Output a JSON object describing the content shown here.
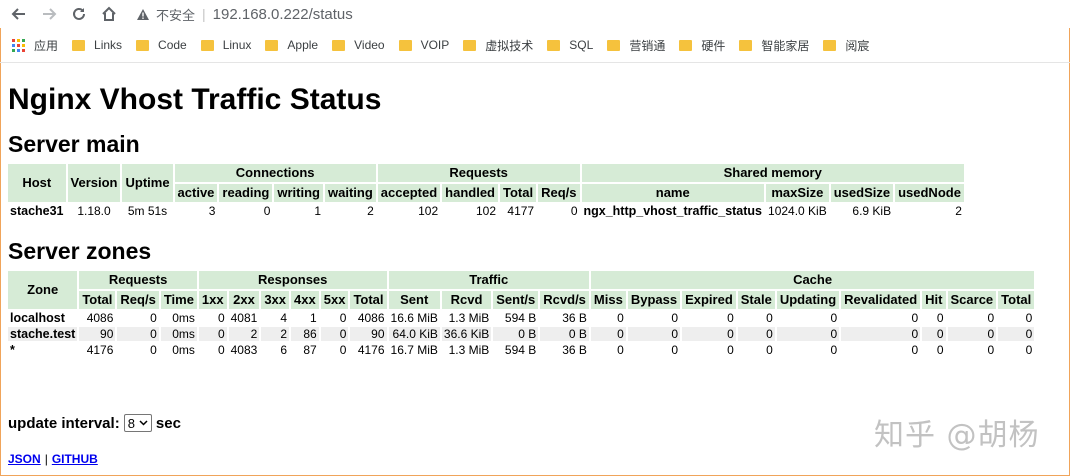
{
  "browser": {
    "insecure_label": "不安全",
    "url": "192.168.0.222/status",
    "bookmarks": [
      {
        "label": "应用",
        "icon": "apps-icon"
      },
      {
        "label": "Links",
        "icon": "folder-icon"
      },
      {
        "label": "Code",
        "icon": "folder-icon"
      },
      {
        "label": "Linux",
        "icon": "folder-icon"
      },
      {
        "label": "Apple",
        "icon": "folder-icon"
      },
      {
        "label": "Video",
        "icon": "folder-icon"
      },
      {
        "label": "VOIP",
        "icon": "folder-icon"
      },
      {
        "label": "虚拟技术",
        "icon": "folder-icon"
      },
      {
        "label": "SQL",
        "icon": "folder-icon"
      },
      {
        "label": "营销通",
        "icon": "folder-icon"
      },
      {
        "label": "硬件",
        "icon": "folder-icon"
      },
      {
        "label": "智能家居",
        "icon": "folder-icon"
      },
      {
        "label": "阅宸",
        "icon": "folder-icon"
      }
    ],
    "icons": {
      "back": "back-arrow-icon",
      "forward": "forward-arrow-icon",
      "reload": "reload-icon",
      "home": "home-icon",
      "warning": "warning-triangle-icon"
    }
  },
  "page": {
    "title": "Nginx Vhost Traffic Status",
    "server_main": {
      "heading": "Server main",
      "groups": {
        "connections": "Connections",
        "requests": "Requests",
        "shared_memory": "Shared memory"
      },
      "headers": {
        "host": "Host",
        "version": "Version",
        "uptime": "Uptime",
        "active": "active",
        "reading": "reading",
        "writing": "writing",
        "waiting": "waiting",
        "accepted": "accepted",
        "handled": "handled",
        "total": "Total",
        "req_s": "Req/s",
        "name": "name",
        "max_size": "maxSize",
        "used_size": "usedSize",
        "used_node": "usedNode"
      },
      "row": {
        "host": "stache31",
        "version": "1.18.0",
        "uptime": "5m 51s",
        "active": "3",
        "reading": "0",
        "writing": "1",
        "waiting": "2",
        "accepted": "102",
        "handled": "102",
        "total": "4177",
        "req_s": "0",
        "name": "ngx_http_vhost_traffic_status",
        "max_size": "1024.0 KiB",
        "used_size": "6.9 KiB",
        "used_node": "2"
      }
    },
    "server_zones": {
      "heading": "Server zones",
      "groups": {
        "zone": "Zone",
        "requests": "Requests",
        "responses": "Responses",
        "traffic": "Traffic",
        "cache": "Cache"
      },
      "headers": {
        "total": "Total",
        "req_s": "Req/s",
        "time": "Time",
        "r1xx": "1xx",
        "r2xx": "2xx",
        "r3xx": "3xx",
        "r4xx": "4xx",
        "r5xx": "5xx",
        "r_total": "Total",
        "sent": "Sent",
        "rcvd": "Rcvd",
        "sent_s": "Sent/s",
        "rcvd_s": "Rcvd/s",
        "miss": "Miss",
        "bypass": "Bypass",
        "expired": "Expired",
        "stale": "Stale",
        "updating": "Updating",
        "revalidated": "Revalidated",
        "hit": "Hit",
        "scarce": "Scarce",
        "c_total": "Total"
      },
      "rows": [
        {
          "zone": "localhost",
          "total": "4086",
          "req_s": "0",
          "time": "0ms",
          "r1xx": "0",
          "r2xx": "4081",
          "r3xx": "4",
          "r4xx": "1",
          "r5xx": "0",
          "r_total": "4086",
          "sent": "16.6 MiB",
          "rcvd": "1.3 MiB",
          "sent_s": "594 B",
          "rcvd_s": "36 B",
          "miss": "0",
          "bypass": "0",
          "expired": "0",
          "stale": "0",
          "updating": "0",
          "revalidated": "0",
          "hit": "0",
          "scarce": "0",
          "c_total": "0"
        },
        {
          "zone": "stache.test",
          "total": "90",
          "req_s": "0",
          "time": "0ms",
          "r1xx": "0",
          "r2xx": "2",
          "r3xx": "2",
          "r4xx": "86",
          "r5xx": "0",
          "r_total": "90",
          "sent": "64.0 KiB",
          "rcvd": "36.6 KiB",
          "sent_s": "0 B",
          "rcvd_s": "0 B",
          "miss": "0",
          "bypass": "0",
          "expired": "0",
          "stale": "0",
          "updating": "0",
          "revalidated": "0",
          "hit": "0",
          "scarce": "0",
          "c_total": "0"
        },
        {
          "zone": "*",
          "total": "4176",
          "req_s": "0",
          "time": "0ms",
          "r1xx": "0",
          "r2xx": "4083",
          "r3xx": "6",
          "r4xx": "87",
          "r5xx": "0",
          "r_total": "4176",
          "sent": "16.7 MiB",
          "rcvd": "1.3 MiB",
          "sent_s": "594 B",
          "rcvd_s": "36 B",
          "miss": "0",
          "bypass": "0",
          "expired": "0",
          "stale": "0",
          "updating": "0",
          "revalidated": "0",
          "hit": "0",
          "scarce": "0",
          "c_total": "0"
        }
      ]
    },
    "update": {
      "label": "update interval:",
      "selected": "8",
      "unit": "sec"
    },
    "links": {
      "json": "JSON",
      "separator": "|",
      "github": "GITHUB"
    },
    "watermark": "知乎 @胡杨"
  }
}
